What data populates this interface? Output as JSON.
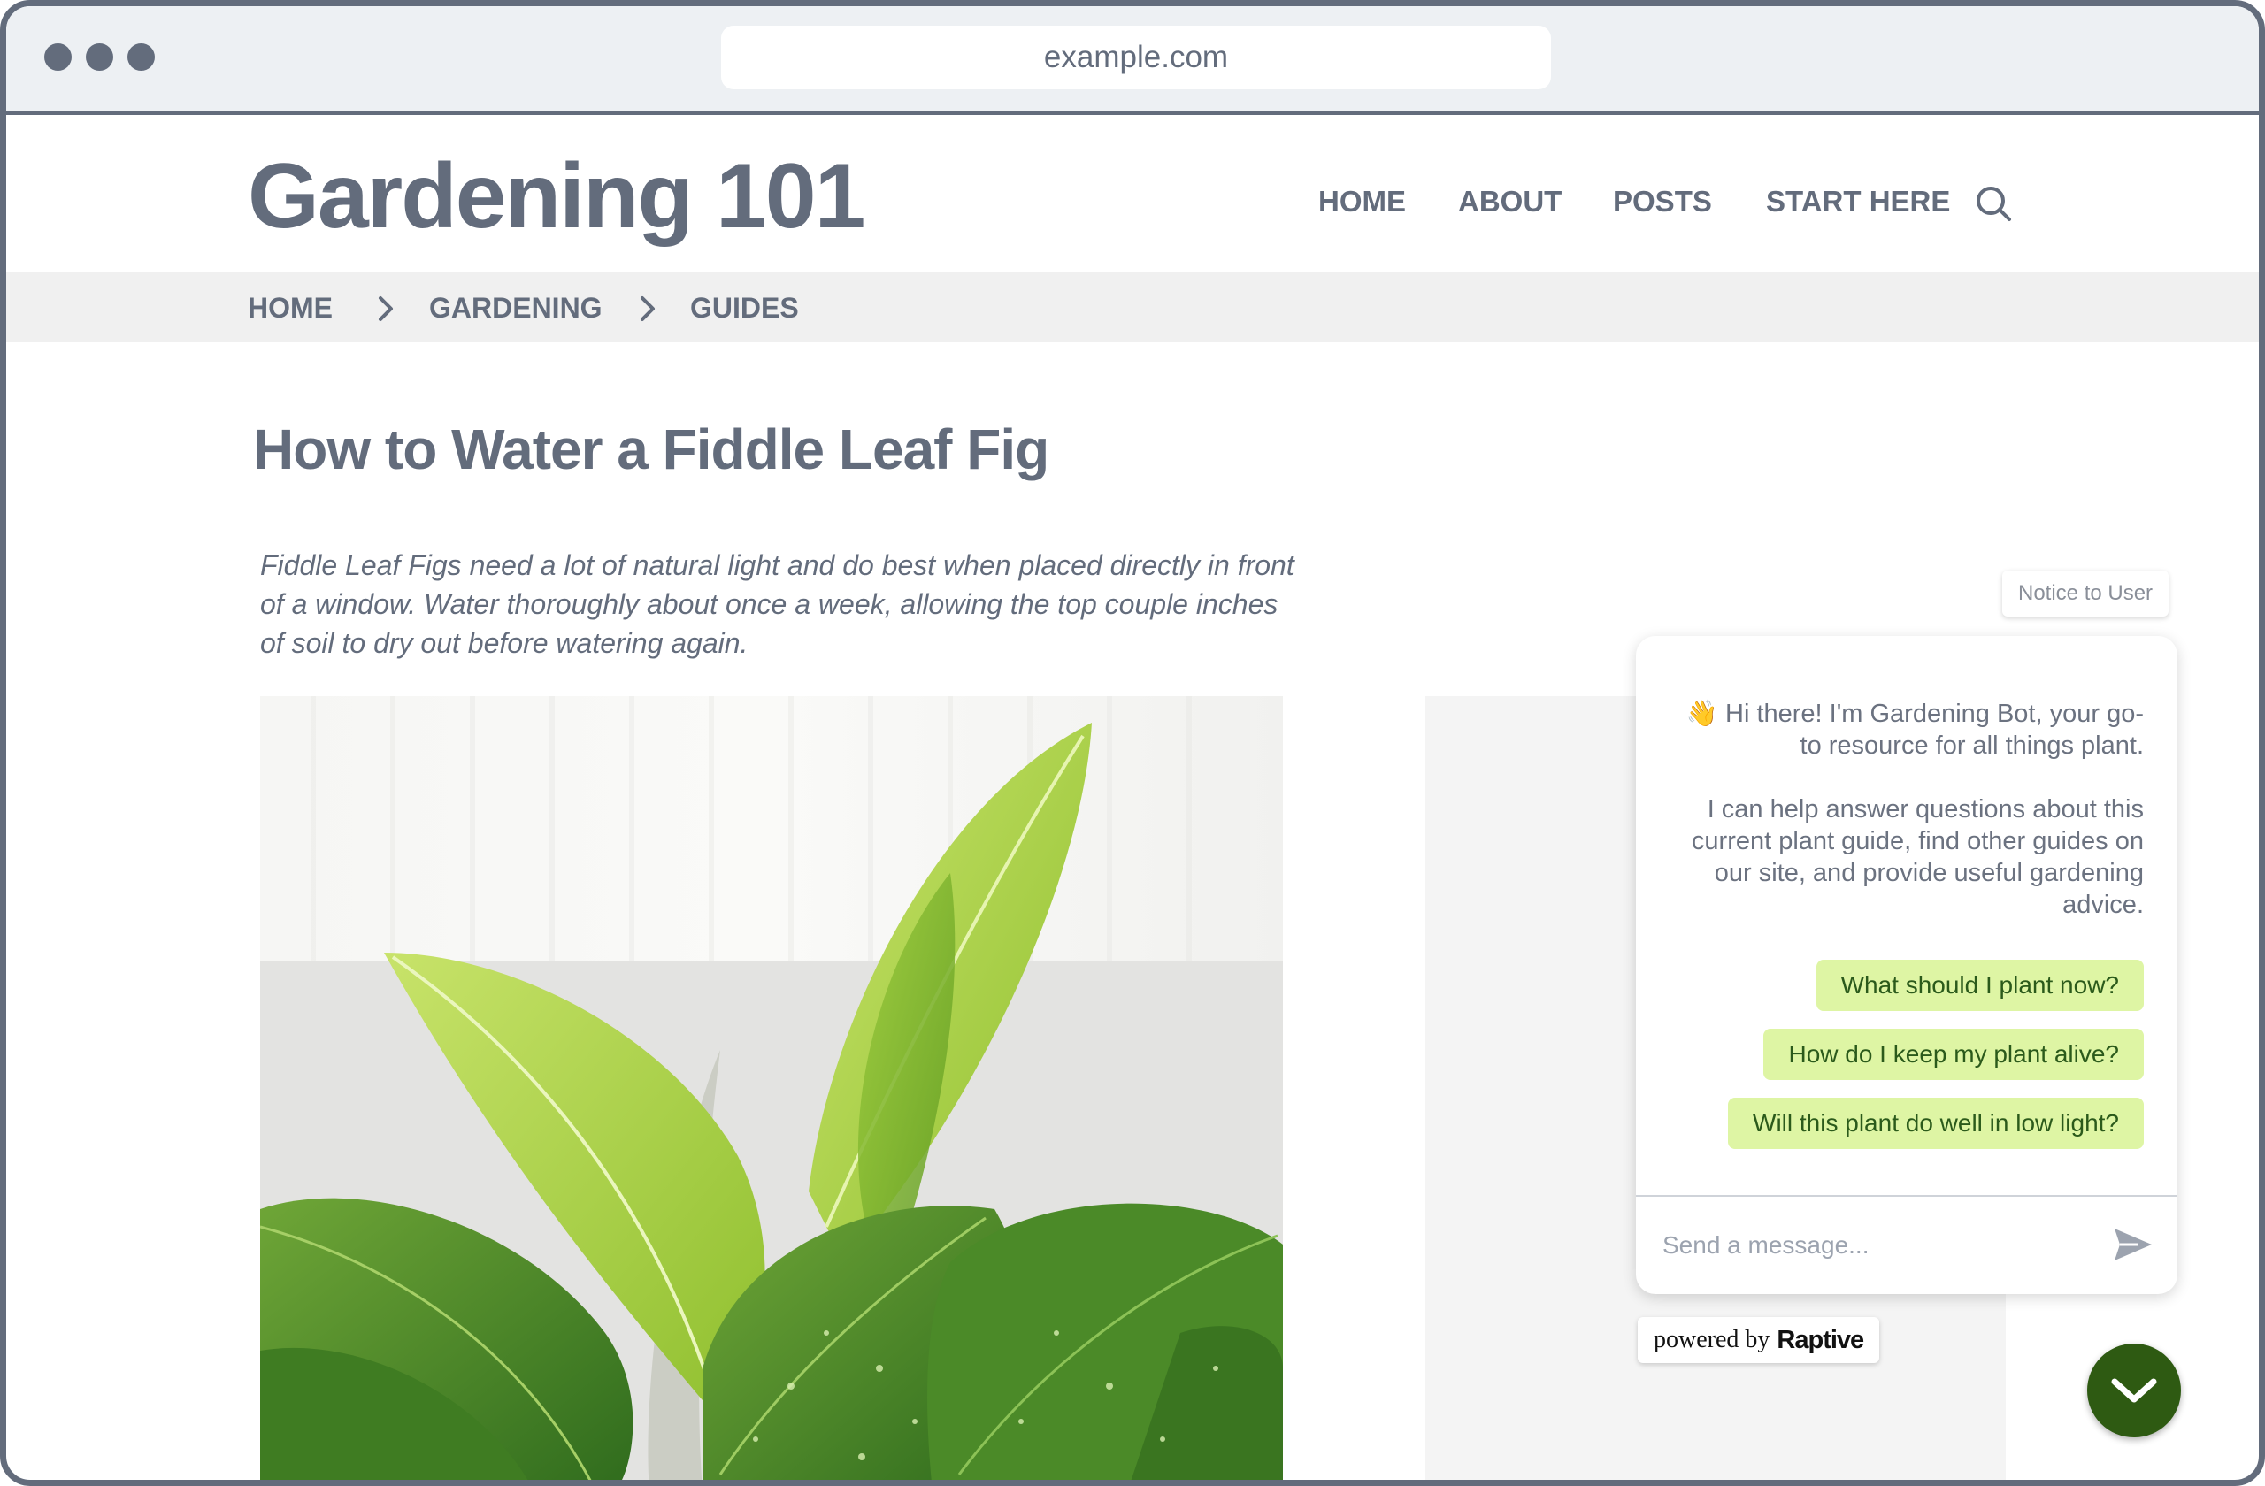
{
  "browser": {
    "url": "example.com"
  },
  "site": {
    "logo": "Gardening 101",
    "nav": [
      "HOME",
      "ABOUT",
      "POSTS",
      "START HERE"
    ]
  },
  "breadcrumb": [
    "HOME",
    "GARDENING",
    "GUIDES"
  ],
  "article": {
    "title": "How to Water a Fiddle Leaf Fig",
    "intro": "Fiddle Leaf Figs need a lot of natural light and do best when placed directly in front of a window. Water thoroughly about once a week, allowing the top couple inches of soil to dry out before watering again."
  },
  "chat": {
    "notice": "Notice to User",
    "greeting": "👋 Hi there! I'm Gardening Bot, your go-to resource for all things plant.",
    "help": "I can help answer questions about this current plant guide, find other guides on our site, and provide useful gardening advice.",
    "suggestions": [
      "What should I plant now?",
      "How do I keep my plant alive?",
      "Will this plant do well in low light?"
    ],
    "input_placeholder": "Send a message...",
    "powered_prefix": "powered by",
    "powered_brand": "Raptive"
  },
  "colors": {
    "text": "#636c7c",
    "suggestion_bg": "#def5a4",
    "suggestion_text": "#2b5a1b",
    "toggle_bg": "#2e5a12"
  },
  "icons": {
    "search": "search-icon",
    "breadcrumb_separator": "chevron-right-icon",
    "send": "send-icon",
    "toggle": "chevron-down-icon"
  }
}
